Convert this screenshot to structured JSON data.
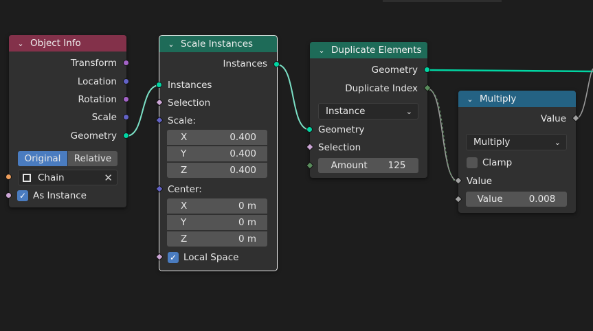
{
  "colors": {
    "geometry_socket": "#00d6a3",
    "vector_socket": "#6363c7",
    "rotation_socket": "#a363c7",
    "float_socket": "#a1a1a1",
    "bool_socket": "#cca6d6",
    "int_socket": "#598c5c",
    "object_socket": "#ed9e5c",
    "header_object_info": "#83314a",
    "header_geometry": "#1e6b58",
    "header_math": "#246283",
    "link": "#7be0c6"
  },
  "object_info": {
    "title": "Object Info",
    "outputs": [
      "Transform",
      "Location",
      "Rotation",
      "Scale",
      "Geometry"
    ],
    "tab_original": "Original",
    "tab_relative": "Relative",
    "object_value": "Chain",
    "as_instance_label": "As Instance",
    "as_instance_checked": true
  },
  "scale_instances": {
    "title": "Scale Instances",
    "output": "Instances",
    "input_instances": "Instances",
    "input_selection": "Selection",
    "scale_label": "Scale:",
    "scale": [
      {
        "axis": "X",
        "value": "0.400"
      },
      {
        "axis": "Y",
        "value": "0.400"
      },
      {
        "axis": "Z",
        "value": "0.400"
      }
    ],
    "center_label": "Center:",
    "center": [
      {
        "axis": "X",
        "value": "0 m"
      },
      {
        "axis": "Y",
        "value": "0 m"
      },
      {
        "axis": "Z",
        "value": "0 m"
      }
    ],
    "local_space_label": "Local Space",
    "local_space_checked": true
  },
  "duplicate_elements": {
    "title": "Duplicate Elements",
    "output_geometry": "Geometry",
    "output_duplicate_index": "Duplicate Index",
    "domain": "Instance",
    "input_geometry": "Geometry",
    "input_selection": "Selection",
    "amount_label": "Amount",
    "amount_value": "125"
  },
  "multiply": {
    "title": "Multiply",
    "output": "Value",
    "operation": "Multiply",
    "clamp_label": "Clamp",
    "clamp_checked": false,
    "input_value_label": "Value",
    "value_field_label": "Value",
    "value_field_value": "0.008"
  }
}
